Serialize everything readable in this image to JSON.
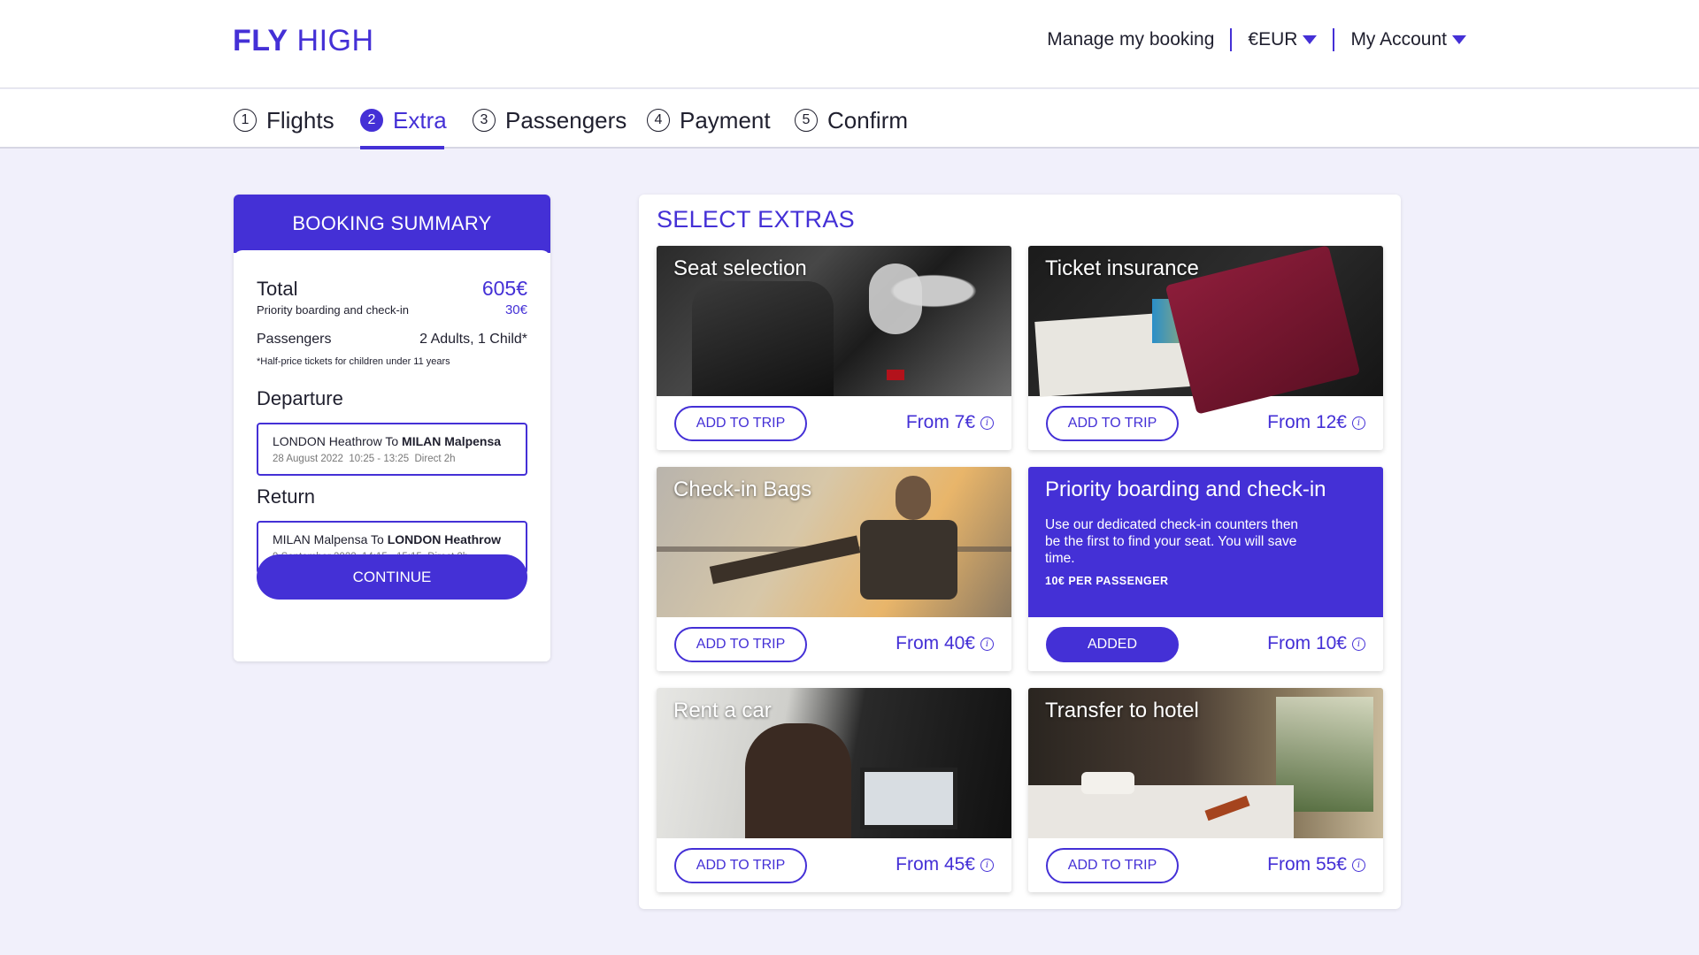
{
  "header": {
    "logo_bold": "FLY",
    "logo_light": "HIGH",
    "manage": "Manage my booking",
    "currency": "€EUR",
    "account": "My Account"
  },
  "steps": [
    {
      "num": "1",
      "label": "Flights"
    },
    {
      "num": "2",
      "label": "Extra"
    },
    {
      "num": "3",
      "label": "Passengers"
    },
    {
      "num": "4",
      "label": "Payment"
    },
    {
      "num": "5",
      "label": "Confirm"
    }
  ],
  "summary": {
    "title": "BOOKING SUMMARY",
    "total_label": "Total",
    "total_value": "605€",
    "extra_label": "Priority boarding and check-in",
    "extra_value": "30€",
    "passengers_label": "Passengers",
    "passengers_value": "2 Adults, 1 Child*",
    "child_note": "*Half-price tickets for children under 11 years",
    "departure_title": "Departure",
    "departure": {
      "from": "LONDON Heathrow",
      "to_word": "To",
      "to": "MILAN Malpensa",
      "date": "28 August 2022",
      "time": "10:25 - 13:25",
      "type": "Direct 2h"
    },
    "return_title": "Return",
    "return": {
      "from": "MILAN Malpensa",
      "to_word": "To",
      "to": "LONDON Heathrow",
      "date": "9 September 2022",
      "time": "14:15 - 15:15",
      "type": "Direct 2h"
    },
    "continue_label": "CONTINUE"
  },
  "extras": {
    "title": "SELECT EXTRAS",
    "cards": [
      {
        "title": "Seat selection",
        "button": "ADD TO TRIP",
        "price": "From 7€"
      },
      {
        "title": "Ticket insurance",
        "button": "ADD TO TRIP",
        "price": "From 12€"
      },
      {
        "title": "Check-in Bags",
        "button": "ADD TO TRIP",
        "price": "From 40€"
      },
      {
        "title": "Priority boarding and check-in",
        "button": "ADDED",
        "price": "From 10€",
        "desc": "Use our dedicated check-in counters then be the first to find your seat. You will save time.",
        "per_passenger": "10€ PER PASSENGER"
      },
      {
        "title": "Rent a car",
        "button": "ADD TO TRIP",
        "price": "From 45€"
      },
      {
        "title": "Transfer to hotel",
        "button": "ADD TO TRIP",
        "price": "From 55€"
      }
    ]
  },
  "colors": {
    "accent": "#4430d6",
    "background": "#f1f0fb"
  }
}
